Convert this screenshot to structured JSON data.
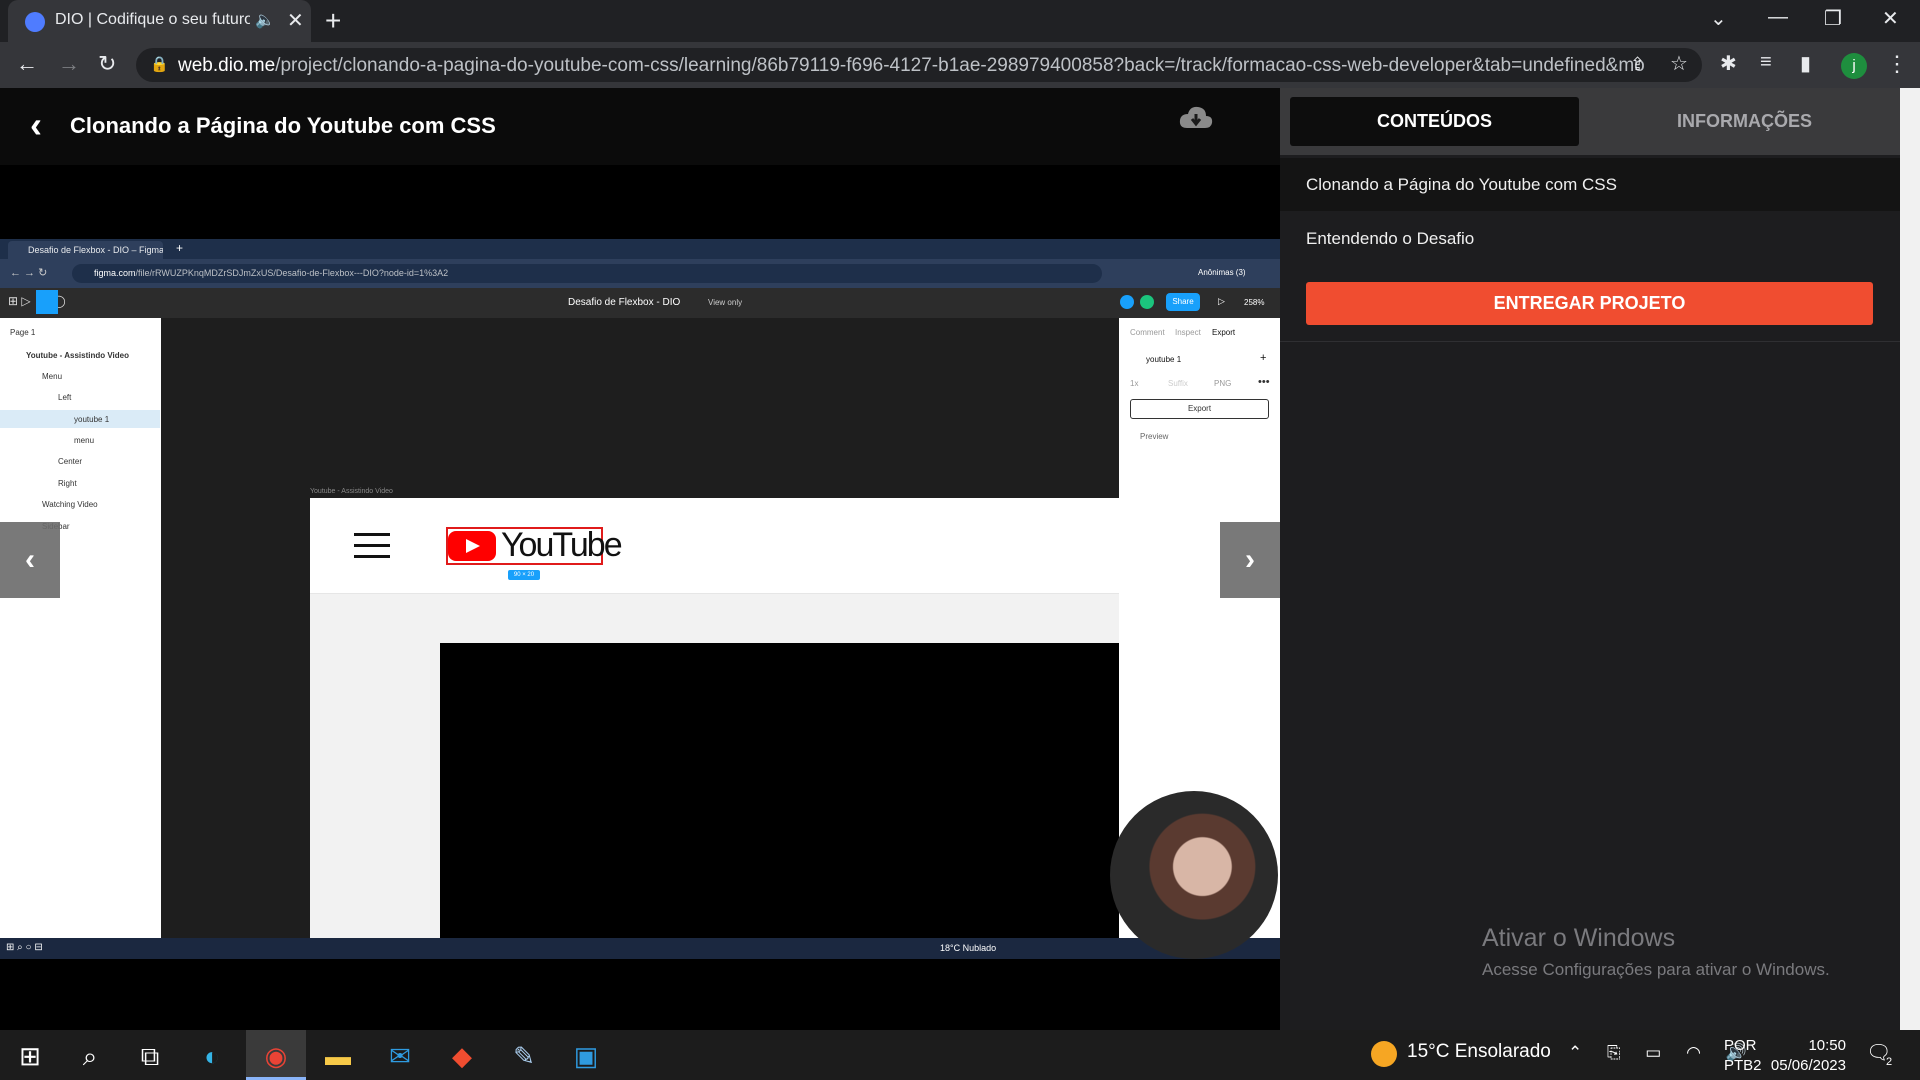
{
  "browser": {
    "tab_title": "DIO | Codifique o seu futuro",
    "url_host": "web.dio.me",
    "url_path": "/project/clonando-a-pagina-do-youtube-com-css/learning/86b79119-f696-4127-b1ae-298979400858?back=/track/formacao-css-web-developer&tab=undefined&moduleId...",
    "profile_initial": "j"
  },
  "page": {
    "course_title": "Clonando a Página do Youtube com CSS"
  },
  "sidebar": {
    "tab_contents": "CONTEÚDOS",
    "tab_info": "INFORMAÇÕES",
    "lessons": [
      "Clonando a Página do Youtube com CSS",
      "Entendendo o Desafio"
    ],
    "deliver_button": "ENTREGAR PROJETO"
  },
  "watermark": {
    "title": "Ativar o Windows",
    "subtitle": "Acesse Configurações para ativar o Windows."
  },
  "video": {
    "inner_tab": "Desafio de Flexbox - DIO – Figma",
    "inner_url_host": "figma.com",
    "inner_url_path": "/file/rRWUZPKnqMDZrSDJmZxUS/Desafio-de-Flexbox---DIO?node-id=1%3A2",
    "inner_profile": "Anônimas (3)",
    "figma_file": "Desafio de Flexbox - DIO",
    "view_only": "View only",
    "share": "Share",
    "zoom": "258%",
    "page_label": "Page 1",
    "layers": [
      "Youtube - Assistindo Video",
      "Menu",
      "Left",
      "youtube 1",
      "menu",
      "Center",
      "Right",
      "Watching Video",
      "Sidebar"
    ],
    "frame_label": "Youtube - Assistindo Video",
    "yt_logo_text": "YouTube",
    "dim_badge": "90 × 20",
    "rpanel_tabs": [
      "Comment",
      "Inspect",
      "Export"
    ],
    "rpanel_layer": "youtube 1",
    "rpanel_scale": "1x",
    "rpanel_suffix": "Suffix",
    "rpanel_format": "PNG",
    "rpanel_export": "Export",
    "rpanel_preview": "Preview",
    "inner_weather": "18°C  Nublado"
  },
  "taskbar": {
    "weather": "15°C  Ensolarado",
    "lang1": "POR",
    "lang2": "PTB2",
    "time": "10:50",
    "date": "05/06/2023",
    "notif_count": "2"
  },
  "colors": {
    "accent": "#f04d30",
    "figma_blue": "#18a0fb"
  }
}
